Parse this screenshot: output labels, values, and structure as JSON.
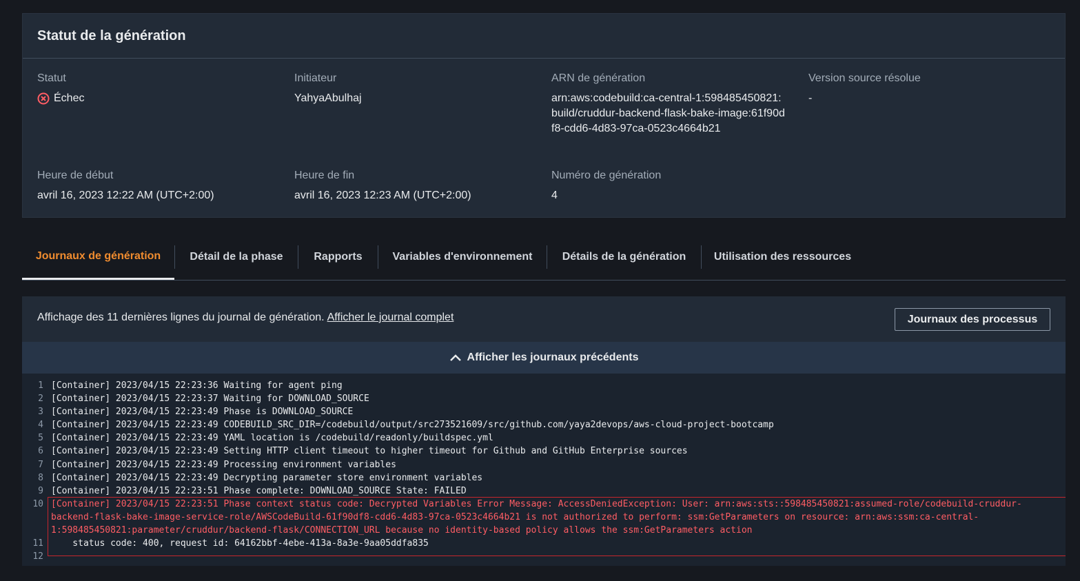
{
  "status_panel": {
    "title": "Statut de la génération",
    "status_label": "Statut",
    "status_value": "Échec",
    "initiator_label": "Initiateur",
    "initiator_value": "YahyaAbulhaj",
    "arn_label": "ARN de génération",
    "arn_value": "arn:aws:codebuild:ca-central-1:598485450821:build/cruddur-backend-flask-bake-image:61f90df8-cdd6-4d83-97ca-0523c4664b21",
    "source_version_label": "Version source résolue",
    "source_version_value": "-",
    "start_label": "Heure de début",
    "start_value": "avril 16, 2023 12:22 AM (UTC+2:00)",
    "end_label": "Heure de fin",
    "end_value": "avril 16, 2023 12:23 AM (UTC+2:00)",
    "build_number_label": "Numéro de génération",
    "build_number_value": "4"
  },
  "tabs": [
    {
      "label": "Journaux de génération",
      "active": true
    },
    {
      "label": "Détail de la phase"
    },
    {
      "label": "Rapports"
    },
    {
      "label": "Variables d'environnement"
    },
    {
      "label": "Détails de la génération"
    },
    {
      "label": "Utilisation des ressources"
    }
  ],
  "logs": {
    "description": "Affichage des 11 dernières lignes du journal de génération.",
    "full_log_link": "Afficher le journal complet",
    "process_logs_button": "Journaux des processus",
    "previous_logs_label": "Afficher les journaux précédents",
    "lines": [
      {
        "n": "1",
        "text": "[Container] 2023/04/15 22:23:36 Waiting for agent ping"
      },
      {
        "n": "2",
        "text": "[Container] 2023/04/15 22:23:37 Waiting for DOWNLOAD_SOURCE"
      },
      {
        "n": "3",
        "text": "[Container] 2023/04/15 22:23:49 Phase is DOWNLOAD_SOURCE"
      },
      {
        "n": "4",
        "text": "[Container] 2023/04/15 22:23:49 CODEBUILD_SRC_DIR=/codebuild/output/src273521609/src/github.com/yaya2devops/aws-cloud-project-bootcamp"
      },
      {
        "n": "5",
        "text": "[Container] 2023/04/15 22:23:49 YAML location is /codebuild/readonly/buildspec.yml"
      },
      {
        "n": "6",
        "text": "[Container] 2023/04/15 22:23:49 Setting HTTP client timeout to higher timeout for Github and GitHub Enterprise sources"
      },
      {
        "n": "7",
        "text": "[Container] 2023/04/15 22:23:49 Processing environment variables"
      },
      {
        "n": "8",
        "text": "[Container] 2023/04/15 22:23:49 Decrypting parameter store environment variables"
      },
      {
        "n": "9",
        "text": "[Container] 2023/04/15 22:23:51 Phase complete: DOWNLOAD_SOURCE State: FAILED"
      },
      {
        "n": "10",
        "text": "[Container] 2023/04/15 22:23:51 Phase context status code: Decrypted Variables Error Message: AccessDeniedException: User: arn:aws:sts::598485450821:assumed-role/codebuild-cruddur-backend-flask-bake-image-service-role/AWSCodeBuild-61f90df8-cdd6-4d83-97ca-0523c4664b21 is not authorized to perform: ssm:GetParameters on resource: arn:aws:ssm:ca-central-1:598485450821:parameter/cruddur/backend-flask/CONNECTION_URL because no identity-based policy allows the ssm:GetParameters action"
      },
      {
        "n": "11",
        "text": "    status code: 400, request id: 64162bbf-4ebe-413a-8a3e-9aa05ddfa835"
      },
      {
        "n": "12",
        "text": ""
      }
    ]
  },
  "colors": {
    "accent_tab": "#f08c2f",
    "error": "#ff5d64",
    "background": "#16191f",
    "panel": "#222b37"
  }
}
